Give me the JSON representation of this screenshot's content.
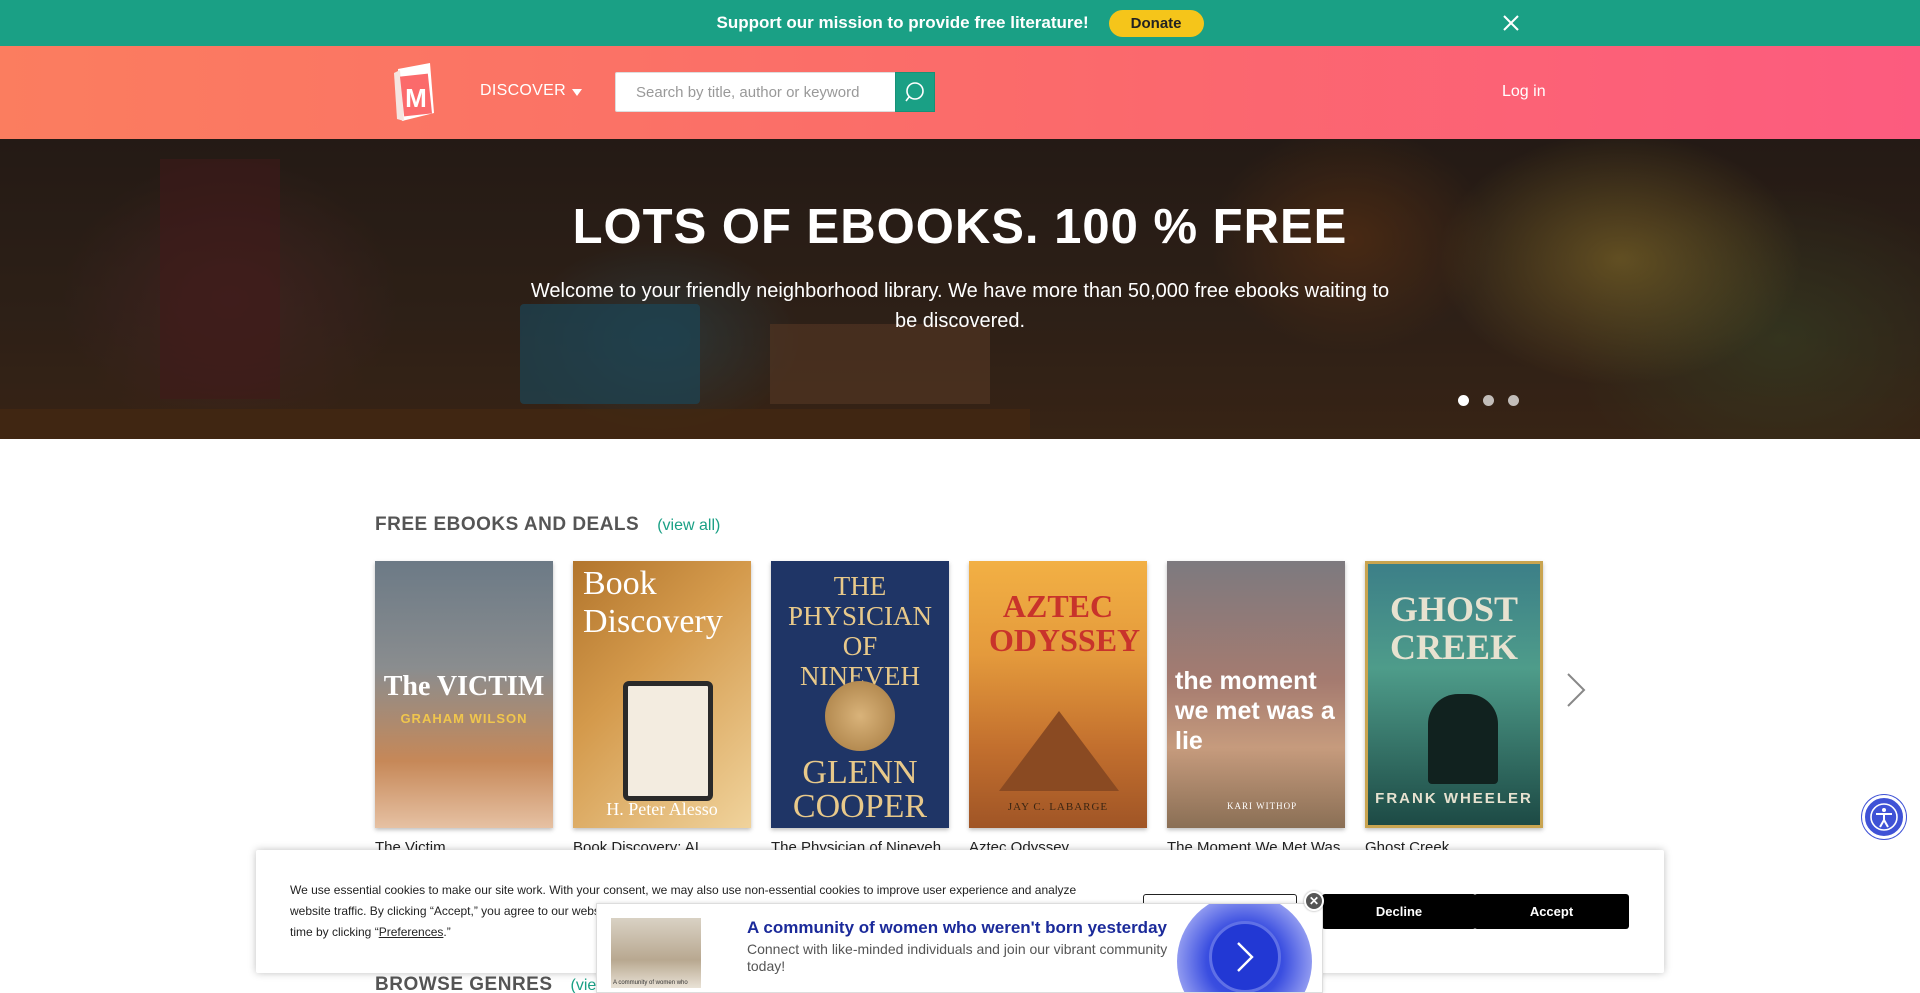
{
  "banner": {
    "message": "Support our mission to provide free literature!",
    "donate_label": "Donate",
    "close_icon": "close-icon"
  },
  "header": {
    "logo_letter": "M",
    "discover_label": "DISCOVER",
    "search_placeholder": "Search by title, author or keyword",
    "login_label": "Log in",
    "colors": {
      "header_start": "#fb7d5f",
      "header_end": "#fc5b7f",
      "accent": "#1aa085"
    }
  },
  "hero": {
    "title": "LOTS OF EBOOKS. 100 % FREE",
    "subtitle": "Welcome to your friendly neighborhood library. We have more than 50,000 free ebooks waiting to be discovered.",
    "slides": 3,
    "active_slide": 1
  },
  "deals": {
    "title": "FREE EBOOKS AND DEALS",
    "view_all": "(view all)",
    "books": [
      {
        "title": "The Victim",
        "cover_line1": "The VICTIM",
        "cover_line2": "GRAHAM WILSON"
      },
      {
        "title": "Book Discovery: AI",
        "cover_line1": "Book Discovery",
        "cover_line2": "H. Peter Alesso"
      },
      {
        "title": "The Physician of Nineveh",
        "cover_line1": "THE PHYSICIAN OF NINEVEH",
        "cover_line2": "GLENN COOPER"
      },
      {
        "title": "Aztec Odyssey",
        "cover_line1": "AZTEC ODYSSEY",
        "cover_line2": "JAY C. LABARGE"
      },
      {
        "title": "The Moment We Met Was",
        "cover_line1": "the moment we met was a lie",
        "cover_line2": "KARI WITHOP"
      },
      {
        "title": "Ghost Creek",
        "cover_line1": "GHOST CREEK",
        "cover_line2": "FRANK WHEELER"
      }
    ]
  },
  "browse": {
    "title": "BROWSE GENRES",
    "view_all": "(view all)"
  },
  "cookie": {
    "text_part1": "We use essential cookies to make our site work. With your consent, we may also use non-essential cookies to improve user experience and analyze website traffic. By clicking “Accept,” you agree to our website's cookie use as described in our Cookie Policy. You can change your cookie settings at any time by clicking “",
    "preferences_link": "Preferences",
    "text_part2": ".”",
    "preferences_label": "Preferences",
    "decline_label": "Decline",
    "accept_label": "Accept"
  },
  "ad": {
    "title": "A community of women who weren't born yesterday",
    "description": "Connect with like-minded individuals and join our vibrant community today!",
    "image_caption": "A community of women who",
    "close_label": "✕"
  }
}
